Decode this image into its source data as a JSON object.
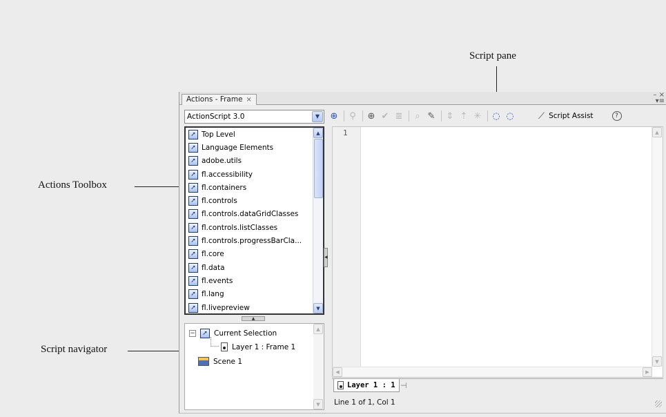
{
  "callouts": {
    "script_pane": "Script pane",
    "actions_toolbox": "Actions Toolbox",
    "script_navigator": "Script navigator"
  },
  "panel": {
    "tab_label": "Actions - Frame",
    "tab_close": "×",
    "window_controls": "– ×",
    "panel_menu": "▾≡"
  },
  "language_select": {
    "value": "ActionScript 3.0"
  },
  "toolbox": {
    "items": [
      "Top Level",
      "Language Elements",
      "adobe.utils",
      "fl.accessibility",
      "fl.containers",
      "fl.controls",
      "fl.controls.dataGridClasses",
      "fl.controls.listClasses",
      "fl.controls.progressBarCla...",
      "fl.core",
      "fl.data",
      "fl.events",
      "fl.lang",
      "fl.livepreview"
    ],
    "item_icon": "book-icon"
  },
  "navigator": {
    "current_selection": "Current Selection",
    "layer_frame": "Layer 1 : Frame 1",
    "scene": "Scene 1"
  },
  "toolbar": {
    "tools": [
      "add-icon",
      "find-icon",
      "target-icon",
      "check-syntax-icon",
      "auto-format-icon",
      "code-hint-icon",
      "debug-icon",
      "collapse-icon",
      "collapse-selection-icon",
      "expand-icon",
      "apply-comment-icon",
      "remove-comment-icon"
    ],
    "script_assist_label": "Script Assist",
    "help_label": "?"
  },
  "script_pane": {
    "line_number": "1",
    "content": ""
  },
  "layer_tab": {
    "label": "Layer 1 : 1"
  },
  "status_bar": {
    "text": "Line 1 of 1, Col 1"
  }
}
